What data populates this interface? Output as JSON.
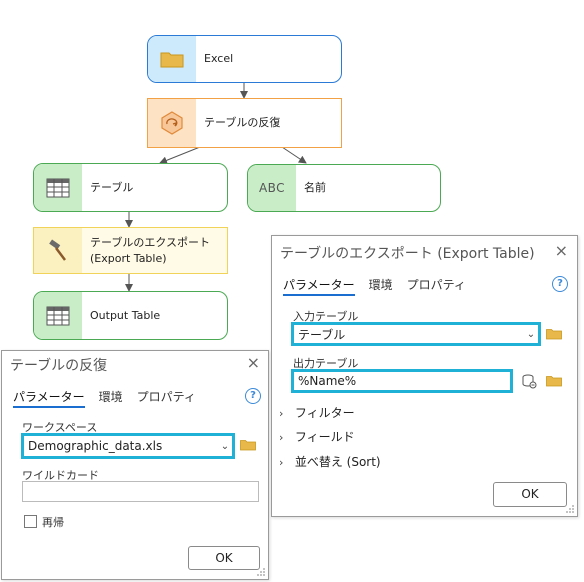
{
  "diagram": {
    "nodes": {
      "excel": {
        "label": "Excel",
        "icon": "folder-icon"
      },
      "iterate": {
        "label": "テーブルの反復",
        "icon": "iterate-icon"
      },
      "table": {
        "label": "テーブル",
        "icon": "table-icon"
      },
      "name": {
        "label": "名前",
        "icon": "abc-icon",
        "icon_text": "ABC"
      },
      "export": {
        "label_line1": "テーブルのエクスポート",
        "label_line2": "(Export Table)",
        "icon": "hammer-icon"
      },
      "output": {
        "label": "Output Table",
        "icon": "table-icon"
      }
    }
  },
  "iterate_dialog": {
    "title": "テーブルの反復",
    "close": "×",
    "tabs": [
      "パラメーター",
      "環境",
      "プロパティ"
    ],
    "help": "?",
    "workspace_label": "ワークスペース",
    "workspace_value": "Demographic_data.xls",
    "wildcard_label": "ワイルドカード",
    "wildcard_value": "",
    "recursive_label": "再帰",
    "ok": "OK"
  },
  "export_dialog": {
    "title": "テーブルのエクスポート (Export Table)",
    "close": "×",
    "tabs": [
      "パラメーター",
      "環境",
      "プロパティ"
    ],
    "help": "?",
    "input_label": "入力テーブル",
    "input_value": "テーブル",
    "output_label": "出力テーブル",
    "output_value": "%Name%",
    "sections": [
      "フィルター",
      "フィールド",
      "並べ替え (Sort)"
    ],
    "ok": "OK"
  },
  "colors": {
    "highlight": "#1fb1d6",
    "accent": "#1a6ecf",
    "data_fill": "#cdeafc",
    "iterator_fill": "#fde2c4",
    "variable_fill": "#c8edc7",
    "tool_fill": "#fbf0bf"
  }
}
